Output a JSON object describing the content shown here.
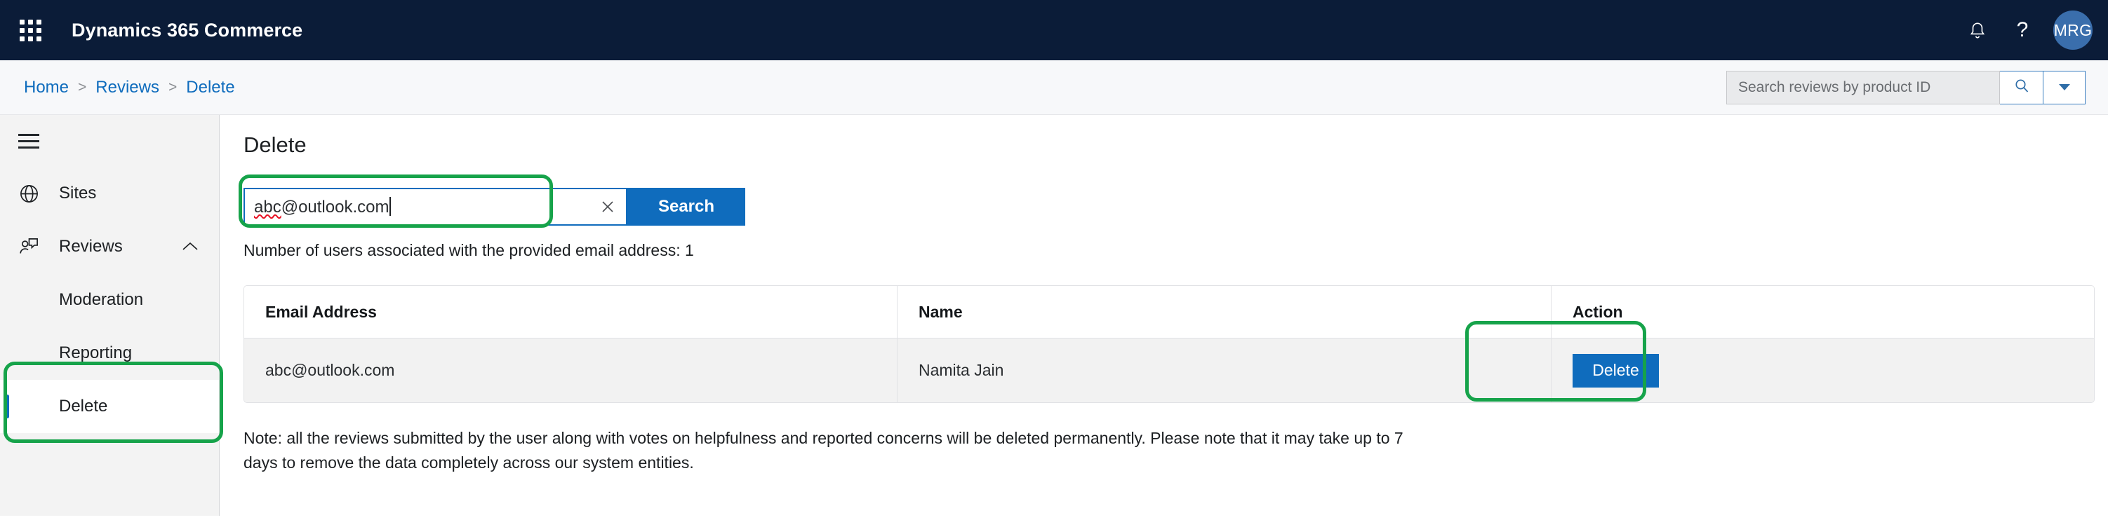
{
  "header": {
    "app_title": "Dynamics 365 Commerce",
    "waffle_icon": "app-launcher-grid-icon",
    "notification_icon": "bell-icon",
    "help_label": "?",
    "avatar_initials": "MRG"
  },
  "breadcrumb": {
    "items": [
      {
        "label": "Home"
      },
      {
        "label": "Reviews"
      },
      {
        "label": "Delete"
      }
    ],
    "separator": ">"
  },
  "top_search": {
    "placeholder": "Search reviews by product ID",
    "value": "",
    "search_icon": "magnifier-icon",
    "caret_icon": "chevron-down-icon"
  },
  "sidebar": {
    "menu_icon": "hamburger-menu-icon",
    "items": [
      {
        "label": "Sites",
        "icon": "globe-icon",
        "expandable": false,
        "selected": false
      },
      {
        "label": "Reviews",
        "icon": "review-person-icon",
        "expandable": true,
        "chevron": "chevron-up-icon",
        "selected": false
      }
    ],
    "sub_items": [
      {
        "label": "Moderation",
        "selected": false
      },
      {
        "label": "Reporting",
        "selected": false
      },
      {
        "label": "Delete",
        "selected": true
      }
    ]
  },
  "main": {
    "page_title": "Delete",
    "search": {
      "value_misspelled": "abc",
      "value_rest": "@outlook.com",
      "clear_icon": "close-x-icon",
      "button_label": "Search"
    },
    "result_count_text": "Number of users associated with the provided email address: 1",
    "table": {
      "columns": [
        "Email Address",
        "Name",
        "Action"
      ],
      "rows": [
        {
          "email": "abc@outlook.com",
          "name": "Namita Jain",
          "action_label": "Delete"
        }
      ]
    },
    "note": "Note: all the reviews submitted by the user along with votes on helpfulness and reported concerns will be deleted permanently. Please note that it may take up to 7 days to remove the data completely across our system entities."
  },
  "annotations": {
    "highlight_color": "#16a34a",
    "boxes": [
      "sidebar-delete-item",
      "email-search-field",
      "row-delete-button"
    ]
  },
  "colors": {
    "header_bg": "#0b1c38",
    "accent_blue": "#0f6cbd",
    "link_blue": "#0f6cbd",
    "sidebar_bg": "#f3f3f3",
    "table_row_bg": "#f2f2f2",
    "avatar_bg": "#3a6eac"
  }
}
